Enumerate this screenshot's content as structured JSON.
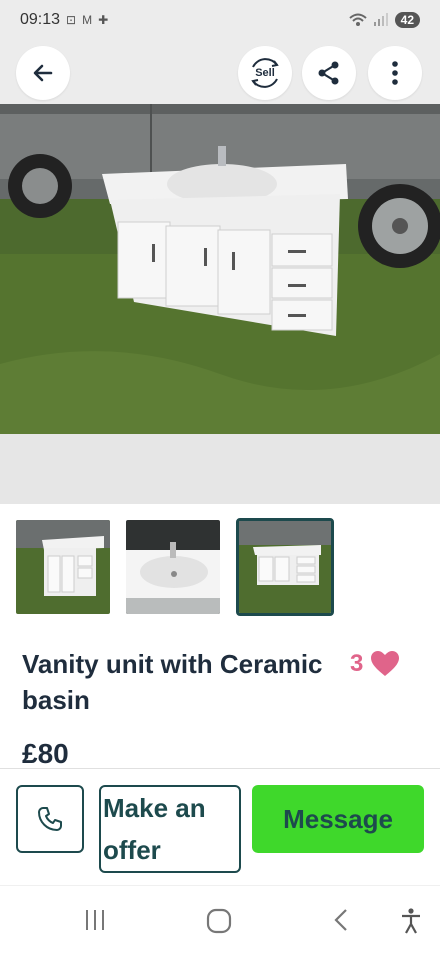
{
  "status_bar": {
    "time": "09:13",
    "notif_icons": [
      "gallery-icon",
      "gmail-icon",
      "app-icon"
    ],
    "battery": "42"
  },
  "top_bar": {
    "sell_label": "Sell"
  },
  "listing": {
    "title": "Vanity unit with Ceramic basin",
    "likes": "3",
    "price": "£80",
    "photos": [
      "photo-1",
      "photo-2",
      "photo-3"
    ],
    "selected_photo": 3
  },
  "actions": {
    "offer_label": "Make an offer",
    "message_label": "Message"
  },
  "colors": {
    "primary": "#1d4a4d",
    "accent_green": "#3fd82b",
    "heart": "#e0648a"
  }
}
